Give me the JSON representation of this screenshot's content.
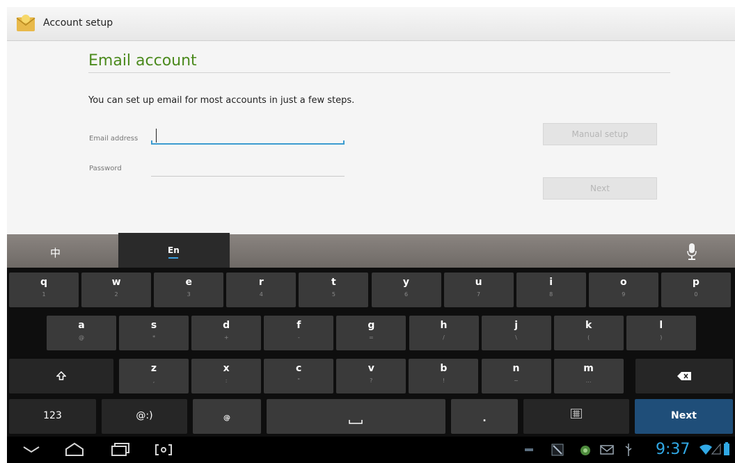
{
  "action_bar": {
    "title": "Account setup",
    "icon": "email-app-icon"
  },
  "form": {
    "title": "Email account",
    "intro": "You can set up email for most accounts in just a few steps.",
    "email_label": "Email address",
    "email_value": "",
    "password_label": "Password",
    "password_value": "",
    "manual_setup_label": "Manual setup",
    "next_label": "Next"
  },
  "keyboard": {
    "lang_zh": "中",
    "lang_en": "En",
    "mic_icon": "microphone-icon",
    "row1": [
      {
        "main": "q",
        "sub": "1"
      },
      {
        "main": "w",
        "sub": "2"
      },
      {
        "main": "e",
        "sub": "3"
      },
      {
        "main": "r",
        "sub": "4"
      },
      {
        "main": "t",
        "sub": "5"
      },
      {
        "main": "y",
        "sub": "6"
      },
      {
        "main": "u",
        "sub": "7"
      },
      {
        "main": "i",
        "sub": "8"
      },
      {
        "main": "o",
        "sub": "9"
      },
      {
        "main": "p",
        "sub": "0"
      }
    ],
    "row2": [
      {
        "main": "a",
        "sub": "@"
      },
      {
        "main": "s",
        "sub": "*"
      },
      {
        "main": "d",
        "sub": "+"
      },
      {
        "main": "f",
        "sub": "-"
      },
      {
        "main": "g",
        "sub": "="
      },
      {
        "main": "h",
        "sub": "/"
      },
      {
        "main": "j",
        "sub": "\\"
      },
      {
        "main": "k",
        "sub": "("
      },
      {
        "main": "l",
        "sub": ")"
      }
    ],
    "row3": [
      {
        "main": "z",
        "sub": ","
      },
      {
        "main": "x",
        "sub": ":"
      },
      {
        "main": "c",
        "sub": "\""
      },
      {
        "main": "v",
        "sub": "?"
      },
      {
        "main": "b",
        "sub": "!"
      },
      {
        "main": "n",
        "sub": "~"
      },
      {
        "main": "m",
        "sub": "…"
      }
    ],
    "shift_icon": "shift-icon",
    "backspace_icon": "backspace-icon",
    "key_123": "123",
    "key_emoticon": "@:)",
    "key_at": "@",
    "key_period": ".",
    "key_next": "Next",
    "keyboard_switch_icon": "keyboard-icon"
  },
  "status_bar": {
    "time": "9:37",
    "icons": [
      "usb-debug-icon",
      "notification-icon",
      "android-icon",
      "gmail-icon",
      "usb-icon",
      "wifi-icon",
      "signal-icon",
      "battery-icon"
    ]
  },
  "nav_bar": {
    "buttons": [
      "hide-keyboard-icon",
      "home-icon",
      "recent-apps-icon",
      "screenshot-icon"
    ]
  }
}
